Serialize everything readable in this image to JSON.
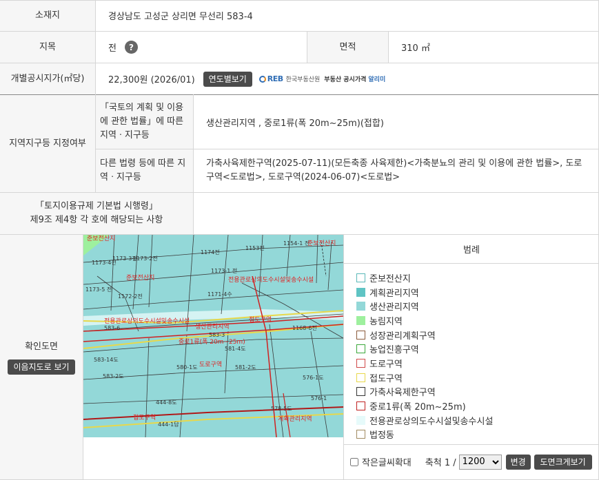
{
  "rows": {
    "address": {
      "label": "소재지",
      "value": "경상남도 고성군 상리면 무선리 583-4"
    },
    "jimok": {
      "label": "지목",
      "value": "전",
      "help": "?"
    },
    "area": {
      "label": "면적",
      "value": "310 ㎡"
    },
    "price": {
      "label": "개별공시지가(㎡당)",
      "value": "22,300원 (2026/01)",
      "button": "연도별보기",
      "logo_mark": "REB",
      "logo_org": "한국부동산원",
      "logo_service_1": "부동산 공시가격",
      "logo_service_2": "알리미"
    },
    "zoning": {
      "label": "지역지구등 지정여부",
      "law1_label": "「국토의 계획 및 이용에 관한 법률」에 따른 지역ㆍ지구등",
      "law1_value": "생산관리지역 , 중로1류(폭 20m~25m)(접합)",
      "law2_label": "다른 법령 등에 따른 지역ㆍ지구등",
      "law2_value_line1": "가축사육제한구역(2025-07-11)(모든축종 사육제한)<가축분뇨의 관리 및 이용에 관한 법률>, 도로",
      "law2_value_line2": "구역<도로법>, 도로구역(2024-06-07)<도로법>"
    },
    "regulation": {
      "label_line1": "「토지이용규제 기본법 시행령」",
      "label_line2": "제9조 제4항 각 호에 해당되는 사항",
      "value": ""
    },
    "map": {
      "label": "확인도면",
      "button": "이음지도로 보기"
    }
  },
  "legend": {
    "title": "범례",
    "items": [
      {
        "label": "준보전산지",
        "fill": "#ffffff",
        "border": "#5ab8b8"
      },
      {
        "label": "계획관리지역",
        "fill": "#5fc4c4",
        "border": "#5fc4c4"
      },
      {
        "label": "생산관리지역",
        "fill": "#93d8d8",
        "border": "#93d8d8"
      },
      {
        "label": "농림지역",
        "fill": "#9ef09e",
        "border": "#9ef09e"
      },
      {
        "label": "성장관리계획구역",
        "fill": "#ffffff",
        "border": "#8a5a3a"
      },
      {
        "label": "농업진흥구역",
        "fill": "#ffffff",
        "border": "#3aa83a"
      },
      {
        "label": "도로구역",
        "fill": "#ffffff",
        "border": "#d04848"
      },
      {
        "label": "접도구역",
        "fill": "#ffffff",
        "border": "#e8d84a"
      },
      {
        "label": "가축사육제한구역",
        "fill": "#ffffff",
        "border": "#333333"
      },
      {
        "label": "중로1류(폭 20m~25m)",
        "fill": "#ffffff",
        "border": "#c02020"
      },
      {
        "label": "전용관로상의도수시설및송수시설",
        "fill": "#e6fafa",
        "border": "#e6fafa"
      },
      {
        "label": "법정동",
        "fill": "#ffffff",
        "border": "#a08a60"
      }
    ]
  },
  "controls": {
    "zoom_text_label": "작은글씨확대",
    "scale_label": "축척 1 /",
    "scale_value": "1200",
    "change_button": "변경",
    "enlarge_button": "도면크게보기"
  },
  "map_labels": {
    "parcels": [
      "1173-4전",
      "1174전",
      "1153전",
      "1154-1 전",
      "1173-3전",
      "1173-2전",
      "1173-1 전",
      "1173-5 전",
      "1172-2전",
      "1171-4수",
      "1168-6전",
      "583-6",
      "583-3",
      "581-4도",
      "583-14도",
      "583-2도",
      "580-1도",
      "581-2도",
      "576-1도",
      "444-8도",
      "444-1답",
      "578-5도",
      "576-1"
    ],
    "zones": [
      "준보전산지",
      "준보전산지",
      "전용관로상의도수시설및송수시설",
      "전용관로상의도수시설및송수시설",
      "생산관리지역",
      "접도구역",
      "중로1류(폭 20m~25m)",
      "도로구역",
      "접도구역",
      "계획관리지역",
      "준보전산지"
    ]
  },
  "colors": {
    "map_bg": "#93d8d8",
    "map_light": "#e6fafa",
    "road_red": "#d02020",
    "road_yellow": "#e8d84a",
    "label_bg": "#f6f6f6",
    "button_dark": "#4b4b4b",
    "logo_blue": "#2f6db5",
    "logo_orange": "#e88a1a"
  }
}
